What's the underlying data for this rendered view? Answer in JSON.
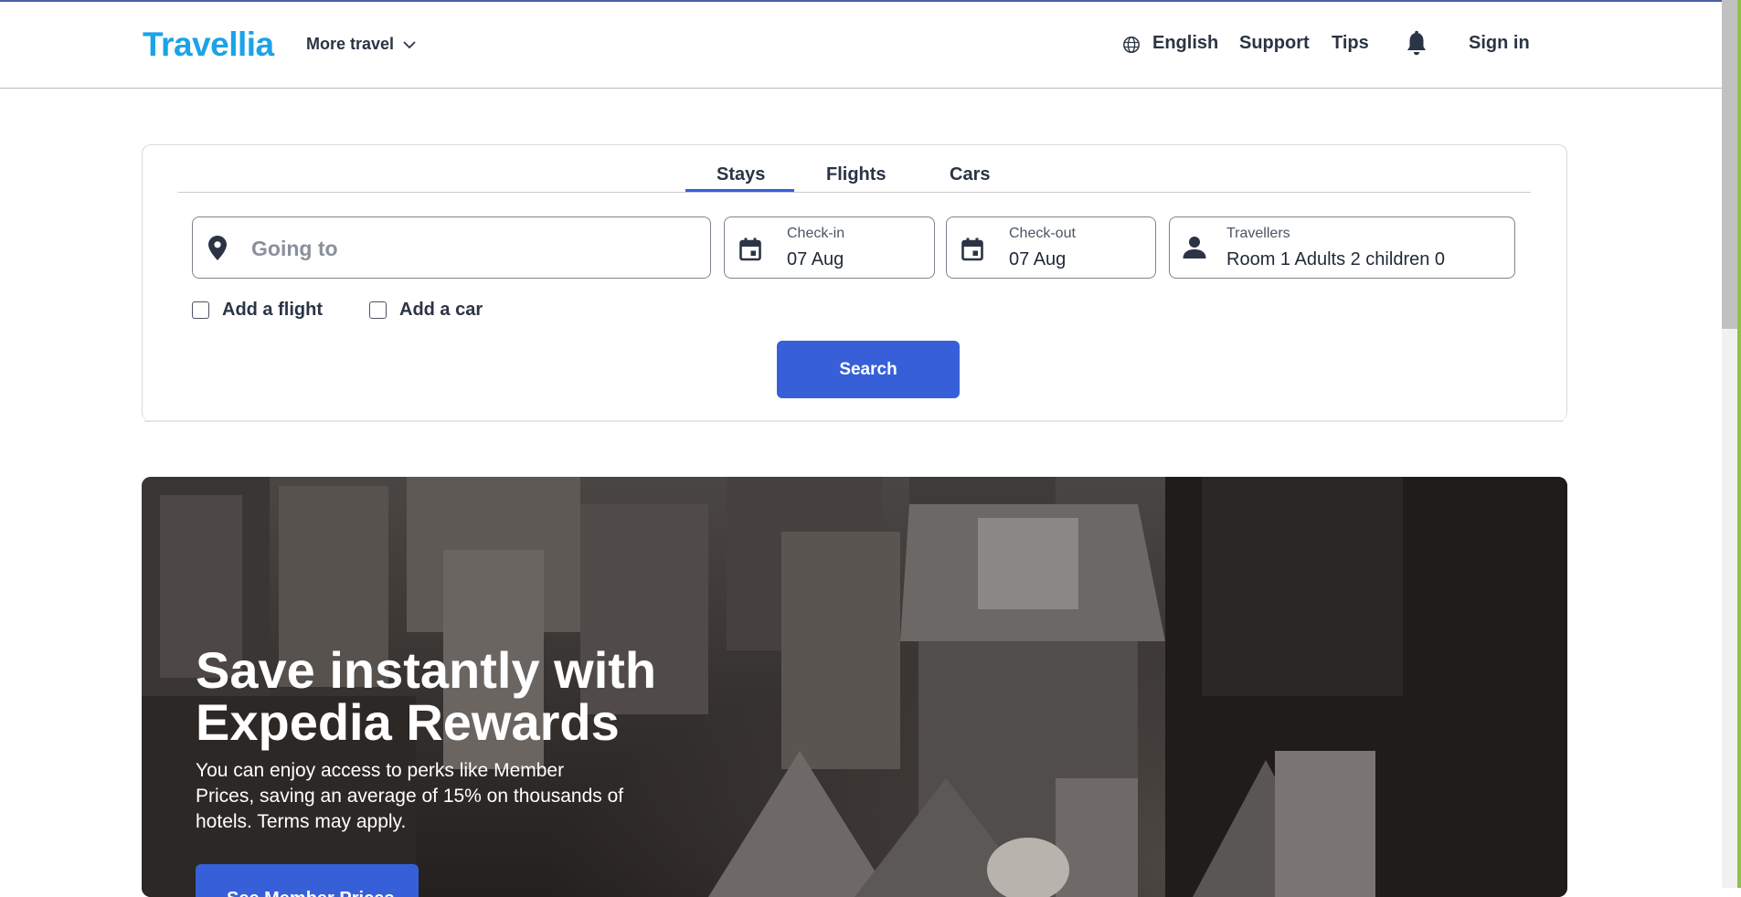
{
  "header": {
    "logo": "Travellia",
    "more_travel": "More travel",
    "language": "English",
    "support": "Support",
    "tips": "Tips",
    "sign_in": "Sign in"
  },
  "tabs": [
    "Stays",
    "Flights",
    "Cars"
  ],
  "active_tab": "Stays",
  "search": {
    "destination_placeholder": "Going to",
    "destination_value": "",
    "checkin_label": "Check-in",
    "checkin_value": "07 Aug",
    "checkout_label": "Check-out",
    "checkout_value": "07 Aug",
    "travellers_label": "Travellers",
    "travellers_value": "Room 1 Adults 2 children 0",
    "add_flight": "Add a flight",
    "add_car": "Add a car",
    "search_button": "Search"
  },
  "hero": {
    "title": "Save instantly with Expedia Rewards",
    "text": "You can enjoy access to perks like Member Prices, saving an average of 15% on thousands of hotels. Terms may apply.",
    "button": "See Member Prices"
  },
  "colors": {
    "brand": "#1ba3e8",
    "primary": "#3760d8",
    "text": "#2b3445"
  },
  "icons": [
    "globe-icon",
    "chevron-down-icon",
    "bell-icon",
    "location-pin-icon",
    "calendar-icon",
    "person-icon",
    "checkbox-icon"
  ]
}
